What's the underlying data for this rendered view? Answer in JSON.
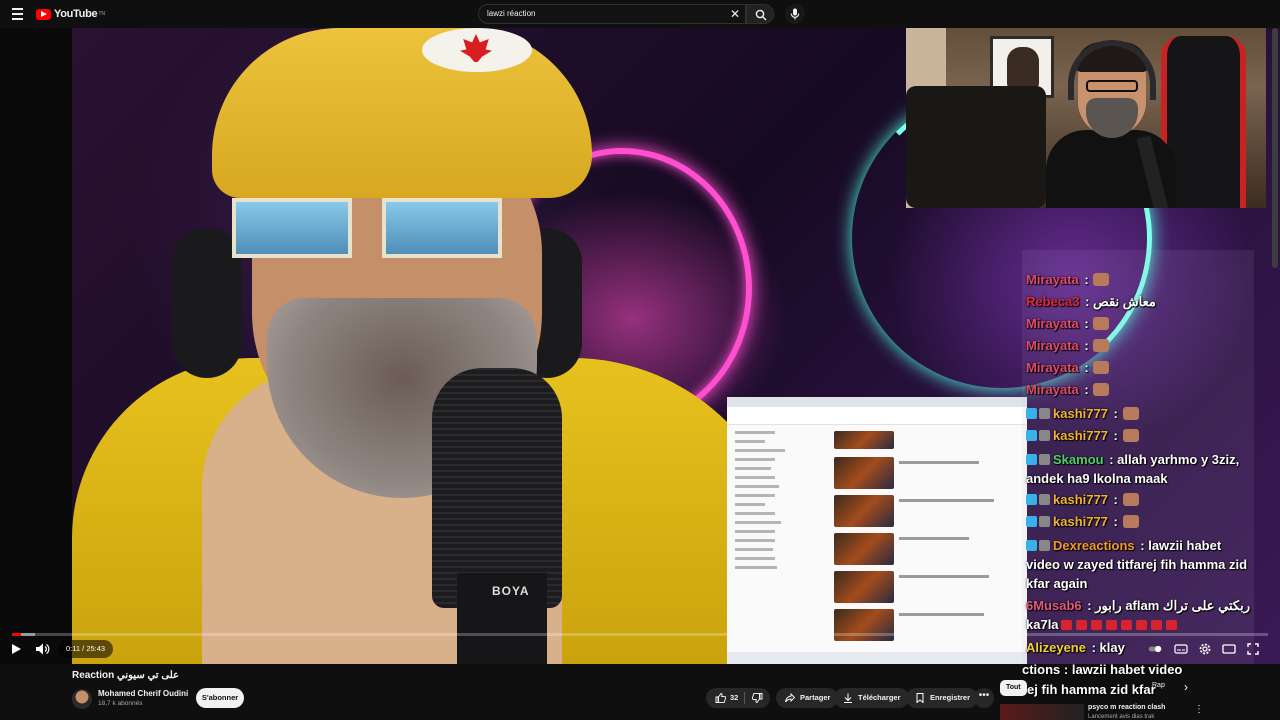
{
  "header": {
    "logo_text": "YouTube",
    "logo_sup": "TN",
    "search_value": "lawzi réaction",
    "icons": [
      "menu-icon",
      "clear-icon",
      "search-icon",
      "mic-icon"
    ]
  },
  "player": {
    "time_current": "0:11",
    "time_separator": " / ",
    "time_total": "25:43",
    "progress_fraction": 0.0071,
    "buffer_fraction": 0.018,
    "mic_brand": "BOYA"
  },
  "chat": {
    "messages": [
      {
        "user": "Mirayata",
        "sep": " : ",
        "text": "",
        "user_color": "#e04a6a",
        "emote": true
      },
      {
        "user": "Rebeca3",
        "sep": " : ",
        "text": "معاش نقص",
        "user_color": "#e02a3a",
        "emote": false
      },
      {
        "user": "Mirayata",
        "sep": " : ",
        "text": "",
        "user_color": "#e04a6a",
        "emote": true
      },
      {
        "user": "Mirayata",
        "sep": " : ",
        "text": "",
        "user_color": "#e04a6a",
        "emote": true
      },
      {
        "user": "Mirayata",
        "sep": " : ",
        "text": "",
        "user_color": "#e04a6a",
        "emote": true
      },
      {
        "user": "Mirayata",
        "sep": " : ",
        "text": "",
        "user_color": "#e04a6a",
        "emote": true
      },
      {
        "user": "kashi777",
        "sep": " : ",
        "text": "",
        "user_color": "#f2b233",
        "emote": true
      },
      {
        "user": "kashi777",
        "sep": " : ",
        "text": "",
        "user_color": "#f2b233",
        "emote": true
      },
      {
        "user": "Skamou",
        "sep": " : ",
        "text": "allah yarhmo y 3ziz, andek ha9 lkolna maak",
        "user_color": "#4fd06a",
        "emote": false
      },
      {
        "user": "kashi777",
        "sep": " : ",
        "text": "",
        "user_color": "#f2b233",
        "emote": true
      },
      {
        "user": "kashi777",
        "sep": " : ",
        "text": "",
        "user_color": "#f2b233",
        "emote": true
      },
      {
        "user": "Dexreactions",
        "sep": " : ",
        "text": "lawzii habet video w zayed titfarej fih hamma zid kfar again",
        "user_color": "#f29a2a",
        "emote": false
      },
      {
        "user": "6Musab6",
        "sep": " : ",
        "text": "رابور aflam ربكتي على تراك ka7la",
        "user_color": "#e05a7a",
        "emote": false
      },
      {
        "user": "Alizeyene",
        "sep": " : ",
        "text": "klay",
        "user_color": "#f2d233",
        "emote": false
      }
    ],
    "overlay_line1": "ctions : lawzii habet video",
    "overlay_line2": "rej fih hamma zid kfar"
  },
  "video": {
    "title": "Reaction على تي سيوني",
    "channel_name": "Mohamed Cherif Oudini",
    "subscribers": "18,7 k abonnés",
    "subscribe_label": "S'abonner",
    "like_count": "32",
    "share_label": "Partager",
    "download_label": "Télécharger",
    "save_label": "Enregistrer",
    "more_label": "•••"
  },
  "sidebar": {
    "chip_all": "Tout",
    "chip_rap": "Rap",
    "rec_title": "psyco m reaction clash",
    "rec_sub": "Lancement avis dias trak"
  },
  "colors": {
    "accent": "#ff0000",
    "background": "#0f0f0f",
    "pill": "#272727"
  }
}
